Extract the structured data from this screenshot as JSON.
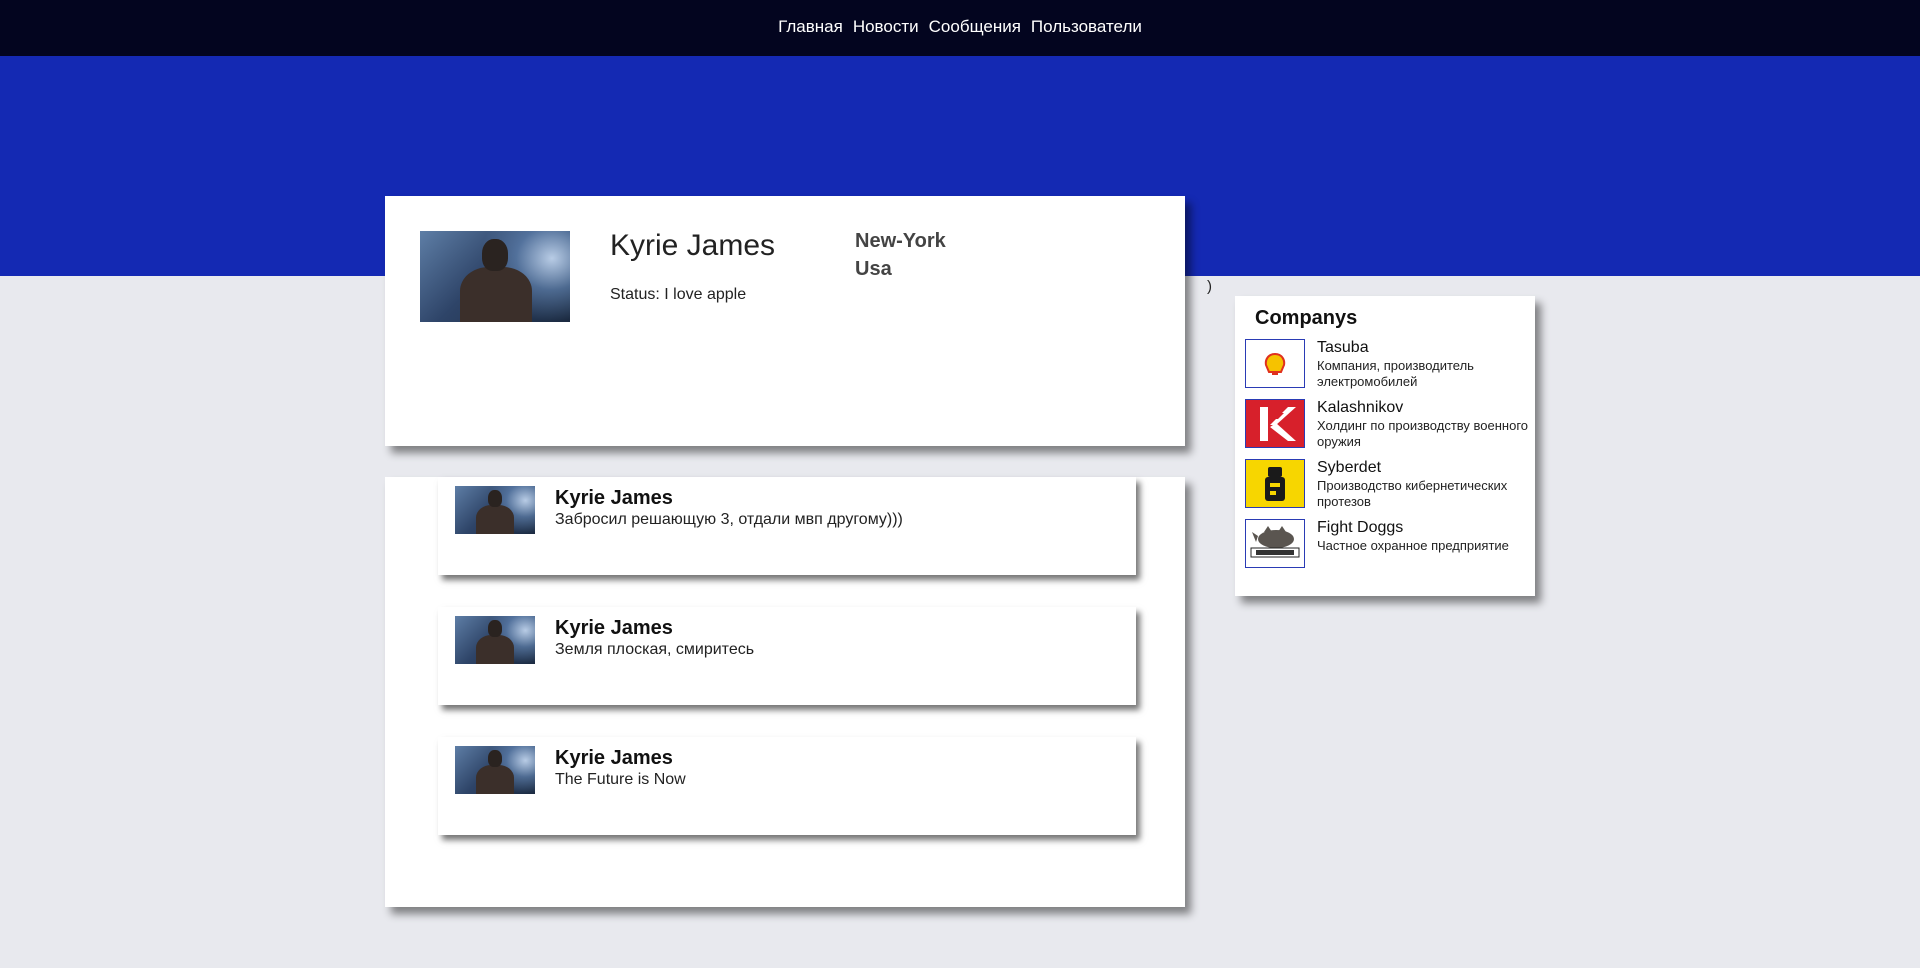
{
  "nav": {
    "items": [
      {
        "label": "Главная"
      },
      {
        "label": "Новости"
      },
      {
        "label": "Сообщения"
      },
      {
        "label": "Пользователи"
      }
    ]
  },
  "profile": {
    "name": "Kyrie James",
    "status": "Status: I love apple",
    "city": "New-York",
    "country": "Usa",
    "avatar": "profile-photo"
  },
  "stray_text": ")",
  "posts": [
    {
      "author": "Kyrie James",
      "text": "Забросил решающую 3, отдали мвп другому)))"
    },
    {
      "author": "Kyrie James",
      "text": "Земля плоская, смиритесь"
    },
    {
      "author": "Kyrie James",
      "text": "The Future is Now"
    }
  ],
  "companies": {
    "title": "Companys",
    "items": [
      {
        "name": "Tasuba",
        "description": "Компания, производитель электромобилей",
        "logo": "shell-logo-icon"
      },
      {
        "name": "Kalashnikov",
        "description": "Холдинг по производству военного оружия",
        "logo": "kalashnikov-logo-icon"
      },
      {
        "name": "Syberdet",
        "description": "Производство кибернетических протезов",
        "logo": "syberdet-logo-icon"
      },
      {
        "name": "Fight Doggs",
        "description": "Частное охранное предприятие",
        "logo": "top-dog-logo-icon"
      }
    ]
  },
  "colors": {
    "nav_bg": "#03051f",
    "banner": "#1429b3",
    "page_bg": "#e8e9ee",
    "card_bg": "#ffffff",
    "logo_border": "#2a3bb5"
  }
}
